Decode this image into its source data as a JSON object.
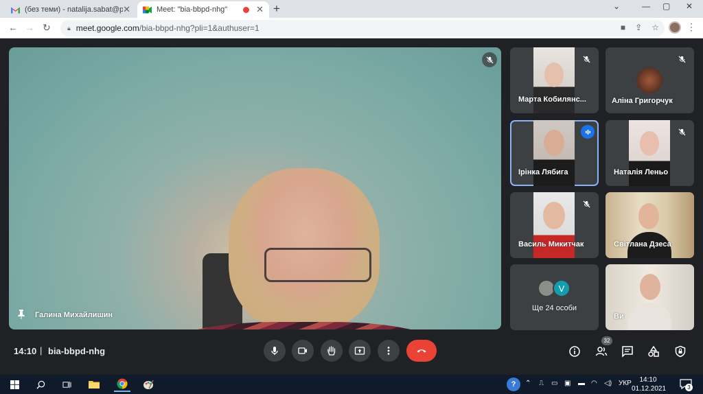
{
  "browser": {
    "tabs": [
      {
        "title": "(без теми) - natalija.sabat@pnu.e",
        "icon": "gmail-icon",
        "active": false
      },
      {
        "title": "Meet: \"bia-bbpd-nhg\"",
        "icon": "meet-icon",
        "active": true,
        "recording": true
      }
    ],
    "url_host": "meet.google.com",
    "url_path": "/bia-bbpd-nhg?pli=1&authuser=1"
  },
  "meeting": {
    "main_speaker": {
      "name": "Галина Михайлишин",
      "pinned": true,
      "muted": true
    },
    "participants": [
      {
        "name": "Марта Кобилянс...",
        "muted": true,
        "speaking": false
      },
      {
        "name": "Аліна Григорчук",
        "muted": true,
        "speaking": false
      },
      {
        "name": "Ірінка Лябига",
        "muted": false,
        "speaking": true
      },
      {
        "name": "Наталія Леньо",
        "muted": true,
        "speaking": false
      },
      {
        "name": "Василь Микитчак",
        "muted": true,
        "speaking": false
      },
      {
        "name": "Світлана Дзеса",
        "muted": false,
        "speaking": false
      },
      {
        "name": "Ще 24 особи",
        "others_initial": "V"
      },
      {
        "name": "Ви",
        "self": true
      }
    ],
    "time": "14:10",
    "separator": "|",
    "code": "bia-bbpd-nhg",
    "participant_count": "32",
    "controls": [
      "mic-icon",
      "camera-icon",
      "raise-hand-icon",
      "present-icon",
      "more-options-icon",
      "leave-call-icon"
    ],
    "right_controls": [
      "info-icon",
      "people-icon",
      "chat-icon",
      "activities-icon",
      "host-controls-icon"
    ],
    "colors": {
      "leave": "#ea4335",
      "speaking": "#1a73e8",
      "outline": "#8ab4f8",
      "bg": "#202124",
      "tile": "#3c4043"
    }
  },
  "taskbar": {
    "lang": "УКР",
    "time": "14:10",
    "date": "01.12.2021",
    "notifications": "3"
  }
}
